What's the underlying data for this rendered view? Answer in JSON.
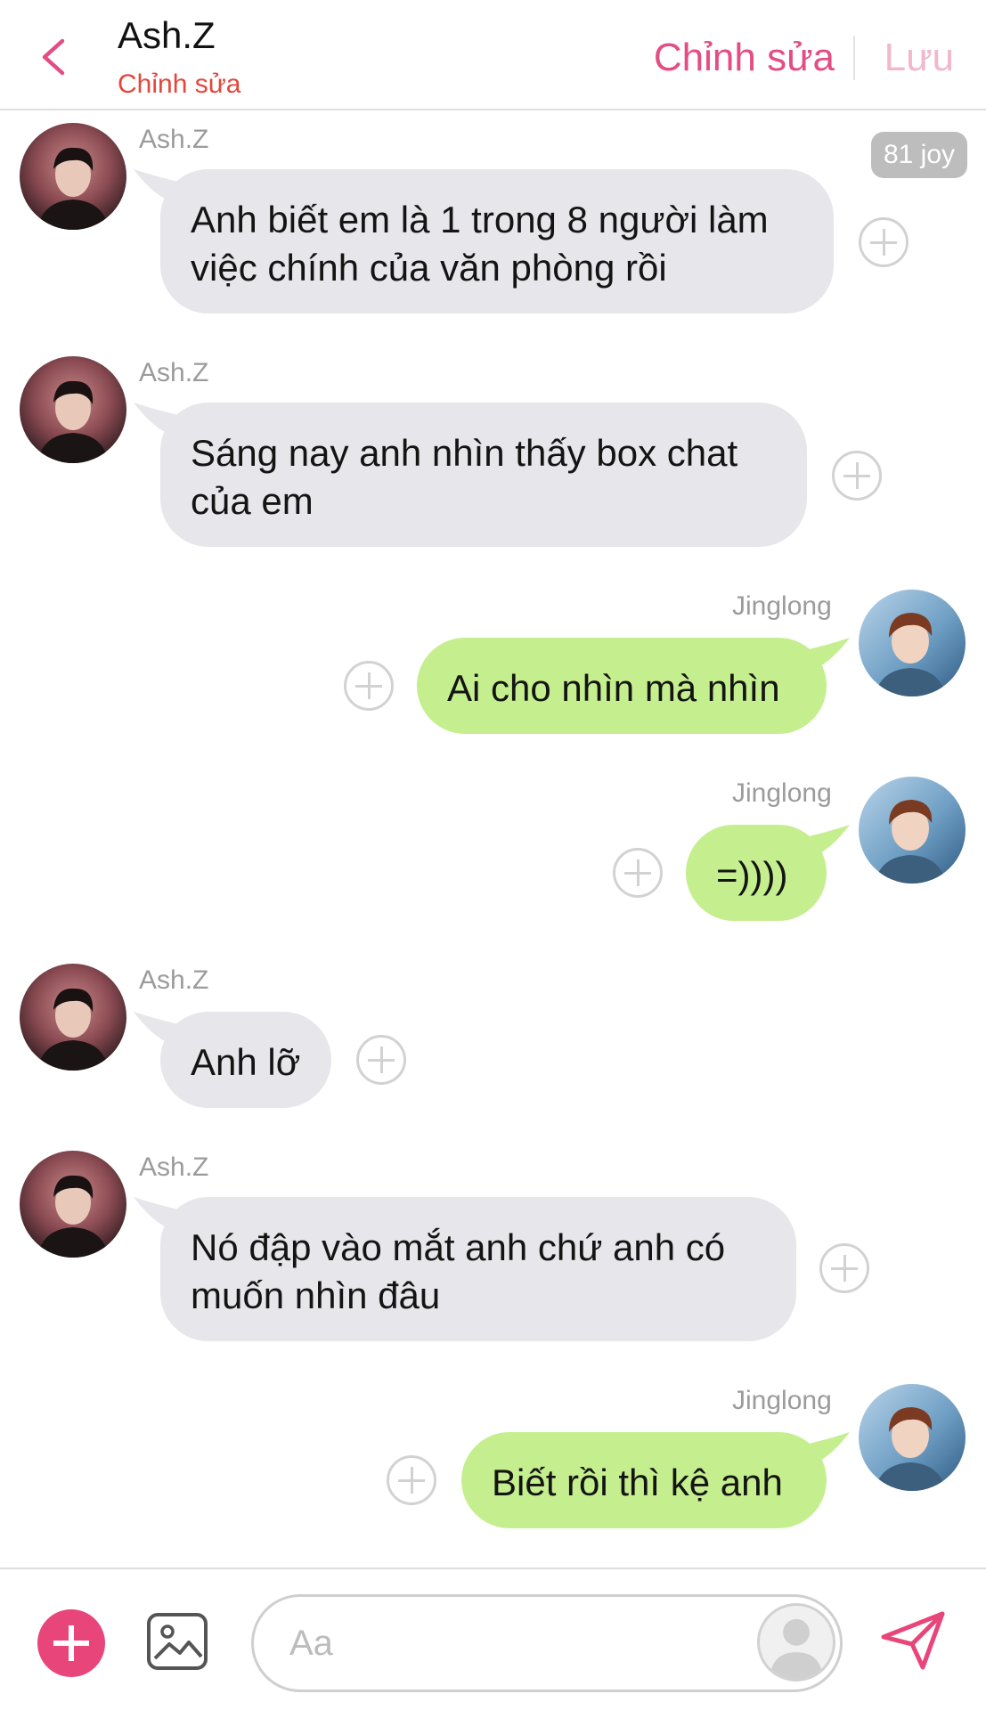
{
  "header": {
    "title": "Ash.Z",
    "subtitle": "Chỉnh sửa",
    "edit_label": "Chỉnh sửa",
    "save_label": "Lưu",
    "back_icon": "chevron-left-icon"
  },
  "joy_badge": "81 joy",
  "messages": [
    {
      "sender": "Ash.Z",
      "side": "in",
      "text_lines": [
        "Anh biết em là 1 trong 8 người làm",
        "việc chính của văn phòng rồi"
      ]
    },
    {
      "sender": "Ash.Z",
      "side": "in",
      "text_lines": [
        "Sáng nay anh nhìn thấy box chat",
        "của em"
      ]
    },
    {
      "sender": "Jinglong",
      "side": "out",
      "text_lines": [
        "Ai cho nhìn mà nhìn"
      ]
    },
    {
      "sender": "Jinglong",
      "side": "out",
      "text_lines": [
        "=))))"
      ]
    },
    {
      "sender": "Ash.Z",
      "side": "in",
      "text_lines": [
        "Anh lỡ"
      ]
    },
    {
      "sender": "Ash.Z",
      "side": "in",
      "text_lines": [
        "Nó đập vào mắt anh chứ anh có",
        "muốn nhìn đâu"
      ]
    },
    {
      "sender": "Jinglong",
      "side": "out",
      "text_lines": [
        "Biết rồi thì kệ anh"
      ]
    }
  ],
  "composer": {
    "placeholder": "Aa",
    "add_icon": "plus-icon",
    "image_icon": "image-icon",
    "send_icon": "send-icon"
  },
  "colors": {
    "accent": "#e34d84",
    "subtitle": "#e3463b",
    "incoming_bubble": "#e6e6eb",
    "outgoing_bubble": "#c5ef8e"
  }
}
